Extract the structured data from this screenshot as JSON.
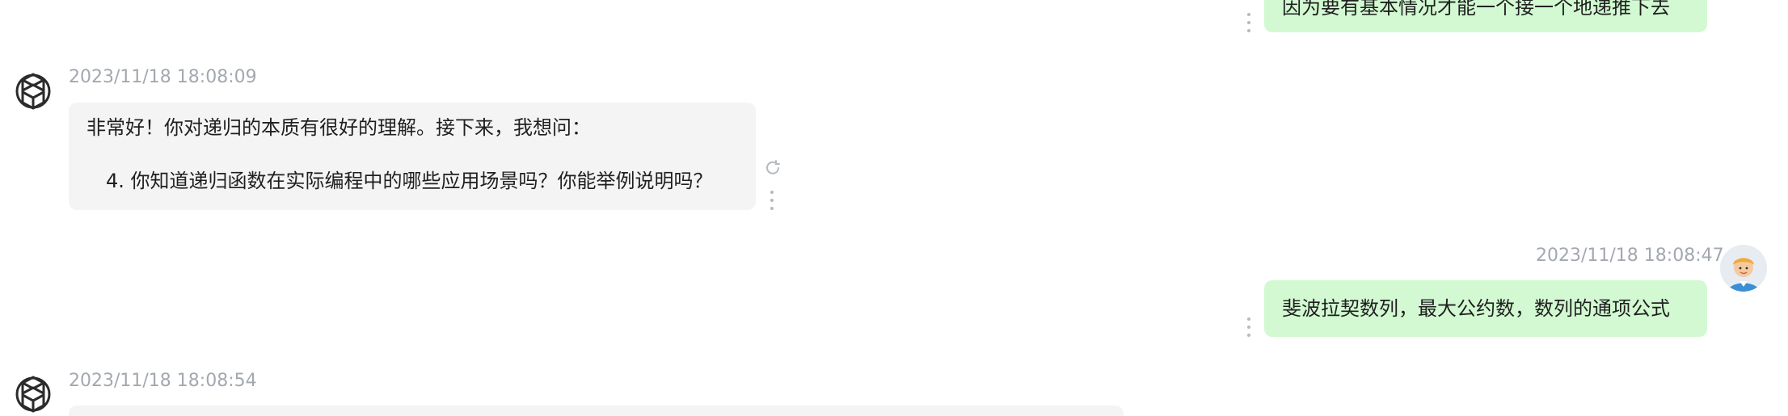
{
  "messages": [
    {
      "role": "user",
      "text": "因为要有基本情况才能一个接一个地递推下去"
    },
    {
      "role": "assistant",
      "timestamp": "2023/11/18 18:08:09",
      "paragraphs": [
        "非常好！你对递归的本质有很好的理解。接下来，我想问：",
        "4. 你知道递归函数在实际编程中的哪些应用场景吗？你能举例说明吗？"
      ]
    },
    {
      "role": "user",
      "timestamp": "2023/11/18 18:08:47",
      "text": "斐波拉契数列，最大公约数，数列的通项公式"
    },
    {
      "role": "assistant",
      "timestamp": "2023/11/18 18:08:54",
      "paragraphs": []
    }
  ],
  "icons": {
    "assistant_logo": "openai-logo-icon",
    "user_avatar": "user-avatar-icon",
    "more": "more-vertical-icon",
    "regenerate": "refresh-icon"
  },
  "colors": {
    "assistant_bubble": "#f4f4f5",
    "user_bubble": "#d2f9d1",
    "timestamp": "#a3a8b0"
  }
}
